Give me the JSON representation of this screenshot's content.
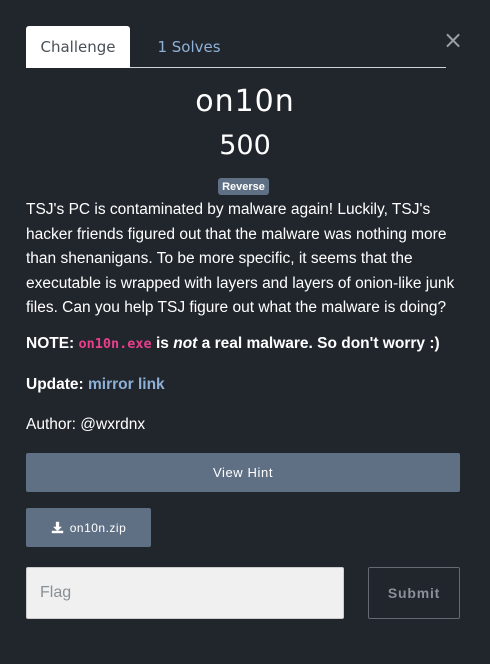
{
  "tabs": [
    {
      "label": "Challenge",
      "active": true
    },
    {
      "label": "1 Solves",
      "active": false
    }
  ],
  "close_icon": "×",
  "challenge": {
    "name": "on10n",
    "points": "500",
    "category": "Reverse"
  },
  "description": {
    "text": "TSJ's PC is contaminated by malware again! Luckily, TSJ's hacker friends figured out that the malware was nothing more than shenanigans. To be more specific, it seems that the executable is wrapped with layers and layers of onion-like junk files. Can you help TSJ figure out what the malware is doing?",
    "note_label": "NOTE:",
    "note_code": "on10n.exe",
    "note_is": "is",
    "note_not": "not",
    "note_rest": "a real malware. So don't worry :)",
    "update_label": "Update:",
    "update_link": "mirror link",
    "author": "Author: @wxrdnx"
  },
  "buttons": {
    "view_hint": "View Hint",
    "file": "on10n.zip",
    "file_icon": "download-icon",
    "submit": "Submit"
  },
  "flag_input": {
    "placeholder": "Flag",
    "value": ""
  },
  "colors": {
    "background": "#21262d",
    "accent": "#5f7085",
    "link": "#8fb1d8",
    "code": "#e83e8c"
  }
}
